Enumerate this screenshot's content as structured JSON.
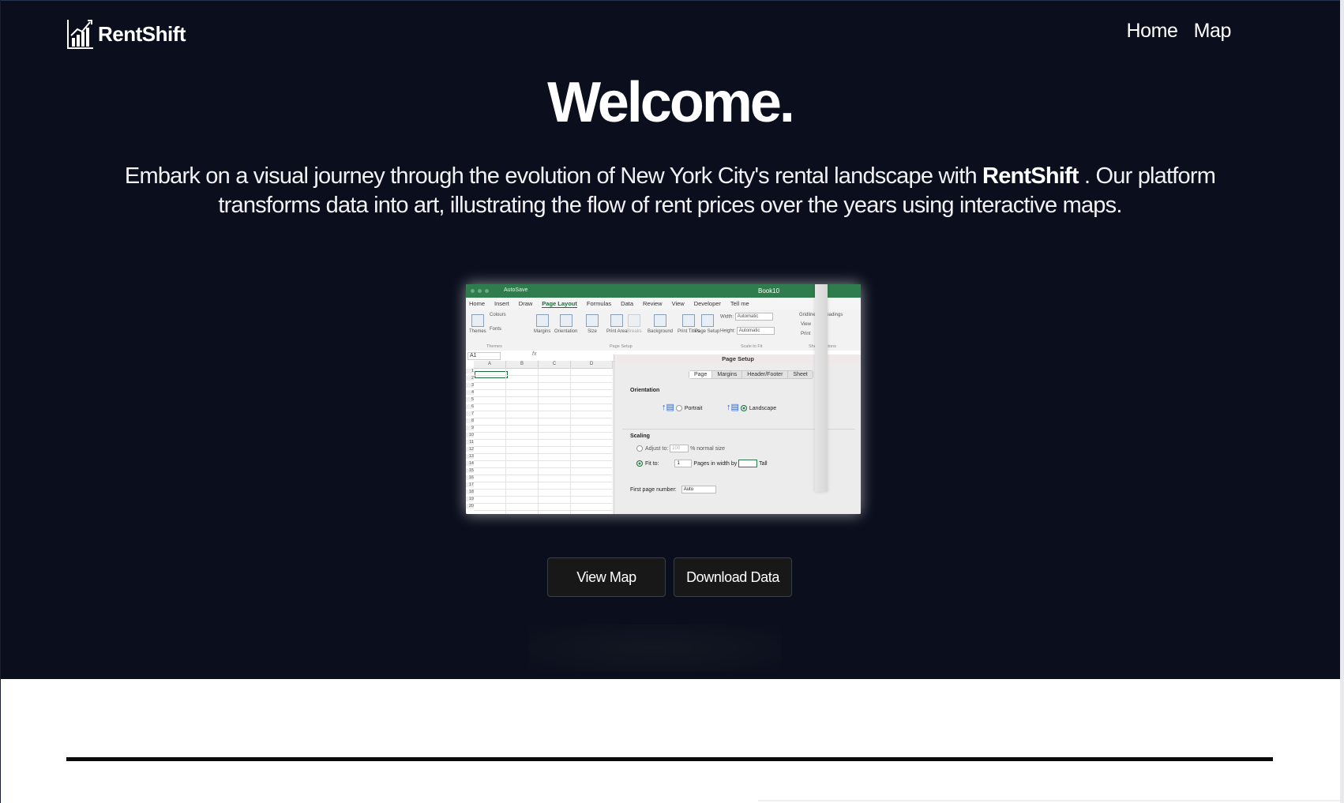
{
  "brand": {
    "name": "RentShift"
  },
  "nav": {
    "items": [
      {
        "label": "Home"
      },
      {
        "label": "Map"
      }
    ]
  },
  "hero": {
    "title": "Welcome.",
    "lead_before": "Embark on a visual journey through the evolution of New York City's rental landscape with ",
    "lead_brand": "RentShift",
    "lead_after": " . Our platform transforms data into art, illustrating the flow of rent prices over the years using interactive maps."
  },
  "preview": {
    "window_title": "Book10",
    "autosave": "AutoSave",
    "ribbon_tabs": [
      "Home",
      "Insert",
      "Draw",
      "Page Layout",
      "Formulas",
      "Data",
      "Review",
      "View",
      "Developer",
      "Tell me"
    ],
    "active_tab": "Page Layout",
    "ribbon_items": [
      "Themes",
      "Colours",
      "Fonts",
      "Margins",
      "Orientation",
      "Size",
      "Print Area",
      "Breaks",
      "Background",
      "Print Titles",
      "Page Setup"
    ],
    "ribbon_groups": [
      "Themes",
      "Page Setup",
      "Scale to Fit",
      "Sheet Options"
    ],
    "scale_width_label": "Width:",
    "scale_width_value": "Automatic",
    "scale_height_label": "Height:",
    "scale_height_value": "Automatic",
    "sheet_options": [
      "Gridlines",
      "Headings",
      "View",
      "Print"
    ],
    "name_box": "A1",
    "columns": [
      "A",
      "B",
      "C",
      "D"
    ],
    "rows": [
      "1",
      "2",
      "3",
      "4",
      "5",
      "6",
      "7",
      "8",
      "9",
      "10",
      "11",
      "12",
      "13",
      "14",
      "15",
      "16",
      "17",
      "18",
      "19",
      "20"
    ],
    "dialog": {
      "title": "Page Setup",
      "tabs": [
        "Page",
        "Margins",
        "Header/Footer",
        "Sheet"
      ],
      "orientation_label": "Orientation",
      "portrait": "Portrait",
      "landscape": "Landscape",
      "scaling_label": "Scaling",
      "adjust_to": "Adjust to:",
      "adjust_value": "100",
      "normal_size": "% normal size",
      "fit_to": "Fit to:",
      "fit_value": "1",
      "pages_wide": "Pages in width by",
      "tall": "Tall",
      "first_page_label": "First page number:",
      "first_page_value": "Auto"
    }
  },
  "actions": {
    "view_map": "View Map",
    "download": "Download Data"
  },
  "colors": {
    "hero_bg": "#0b0f1d",
    "excel_green": "#2f7d4c",
    "button_bg": "#181818"
  }
}
